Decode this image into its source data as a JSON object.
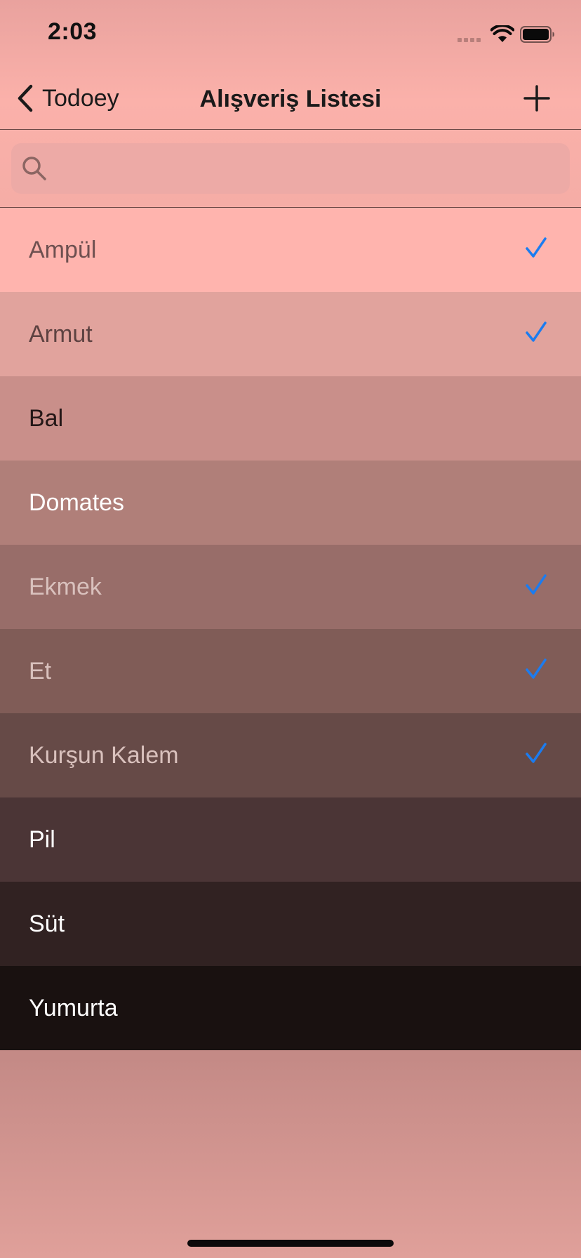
{
  "status_bar": {
    "time": "2:03"
  },
  "nav": {
    "back_label": "Todoey",
    "title": "Alışveriş Listesi",
    "back_icon": "chevron-left-icon",
    "add_icon": "plus-icon"
  },
  "search": {
    "placeholder": "",
    "value": "",
    "icon": "search-icon"
  },
  "items": [
    {
      "label": "Ampül",
      "checked": true,
      "background": "#ffb4ae",
      "text_color": "#6e5050"
    },
    {
      "label": "Armut",
      "checked": true,
      "background": "#e1a39d",
      "text_color": "#5d4241"
    },
    {
      "label": "Bal",
      "checked": false,
      "background": "#c98f8a",
      "text_color": "#241717"
    },
    {
      "label": "Domates",
      "checked": false,
      "background": "#b07f79",
      "text_color": "#ffffff"
    },
    {
      "label": "Ekmek",
      "checked": true,
      "background": "#986d69",
      "text_color": "#d9c1bd"
    },
    {
      "label": "Et",
      "checked": true,
      "background": "#805c57",
      "text_color": "#d9c1bd"
    },
    {
      "label": "Kurşun Kalem",
      "checked": true,
      "background": "#664a47",
      "text_color": "#d9c1bd"
    },
    {
      "label": "Pil",
      "checked": false,
      "background": "#4b3536",
      "text_color": "#ffffff"
    },
    {
      "label": "Süt",
      "checked": false,
      "background": "#312222",
      "text_color": "#ffffff"
    },
    {
      "label": "Yumurta",
      "checked": false,
      "background": "#191110",
      "text_color": "#ffffff"
    }
  ],
  "colors": {
    "accent": "#1b7cf0",
    "nav_text": "#1a1a1a"
  }
}
